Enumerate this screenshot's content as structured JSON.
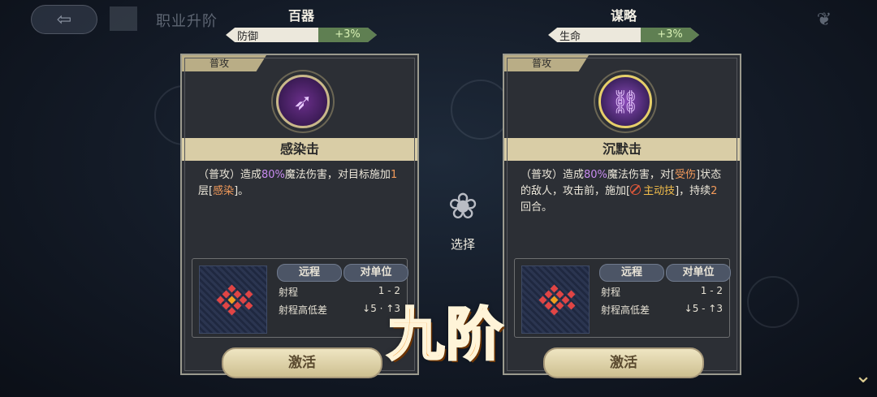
{
  "topbar": {
    "back_icon": "arrow-left-icon",
    "menu_label": "",
    "title": "职业升阶",
    "right_icon": "emblem-icon"
  },
  "options": [
    {
      "name": "百器",
      "stat_label": "防御",
      "stat_value": "+3%",
      "tag": "普攻",
      "skill_icon": "spear-icon",
      "skill_name": "感染击",
      "desc_parts": [
        "（普攻）造成",
        "80%",
        "魔法伤害，对目标施加",
        "1",
        "层[",
        "感染",
        "]。"
      ],
      "range_type": "远程",
      "target_type": "对单位",
      "range_label": "射程",
      "range_value": "1 - 2",
      "height_label": "射程高低差",
      "height_value": "↓5 · ↑3",
      "activate_label": "激活"
    },
    {
      "name": "谋略",
      "stat_label": "生命",
      "stat_value": "+3%",
      "tag": "普攻",
      "skill_icon": "chains-icon",
      "skill_name": "沉默击",
      "desc_parts": [
        "（普攻）造成",
        "80%",
        "魔法伤害，对[",
        "受伤",
        "]状态的敌人，攻击前，施加[",
        "主动技",
        "]，持续",
        "2",
        "回合。"
      ],
      "range_type": "远程",
      "target_type": "对单位",
      "range_label": "射程",
      "range_value": "1 - 2",
      "height_label": "射程高低差",
      "height_value": "↓5 - ↑3",
      "activate_label": "激活"
    }
  ],
  "center": {
    "select_icon": "lotus-emblem-icon",
    "select_label": "选择"
  },
  "overlay_text": "九阶",
  "colors": {
    "accent_purple": "#c98cf0",
    "accent_orange": "#f29a5a",
    "stat_green": "#5f7f52",
    "overlay_orange": "#f08a16"
  }
}
